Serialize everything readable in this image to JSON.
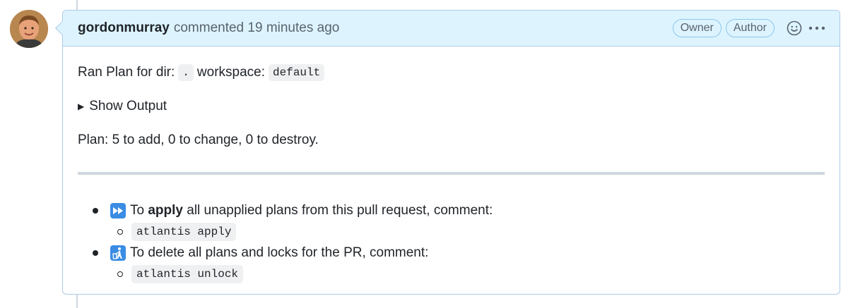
{
  "comment": {
    "author": "gordonmurray",
    "action_text": "commented 19 minutes ago",
    "badges": [
      "Owner",
      "Author"
    ],
    "body": {
      "ran_plan_prefix": "Ran Plan for dir:",
      "dir_value": ".",
      "workspace_label": "workspace:",
      "workspace_value": "default",
      "details_summary": "Show Output",
      "plan_summary": "Plan: 5 to add, 0 to change, 0 to destroy.",
      "actions": [
        {
          "icon": "fast-forward-emoji",
          "text_before": "To ",
          "bold": "apply",
          "text_after": " all unapplied plans from this pull request, comment:",
          "command": "atlantis apply"
        },
        {
          "icon": "litter-bin-emoji",
          "text_before": "To delete all plans and locks for the PR, comment:",
          "bold": "",
          "text_after": "",
          "command": "atlantis unlock"
        }
      ]
    }
  },
  "colors": {
    "header_bg": "#ddf4ff",
    "border": "#aecbe6",
    "emoji_bg": "#3b8ce3"
  }
}
